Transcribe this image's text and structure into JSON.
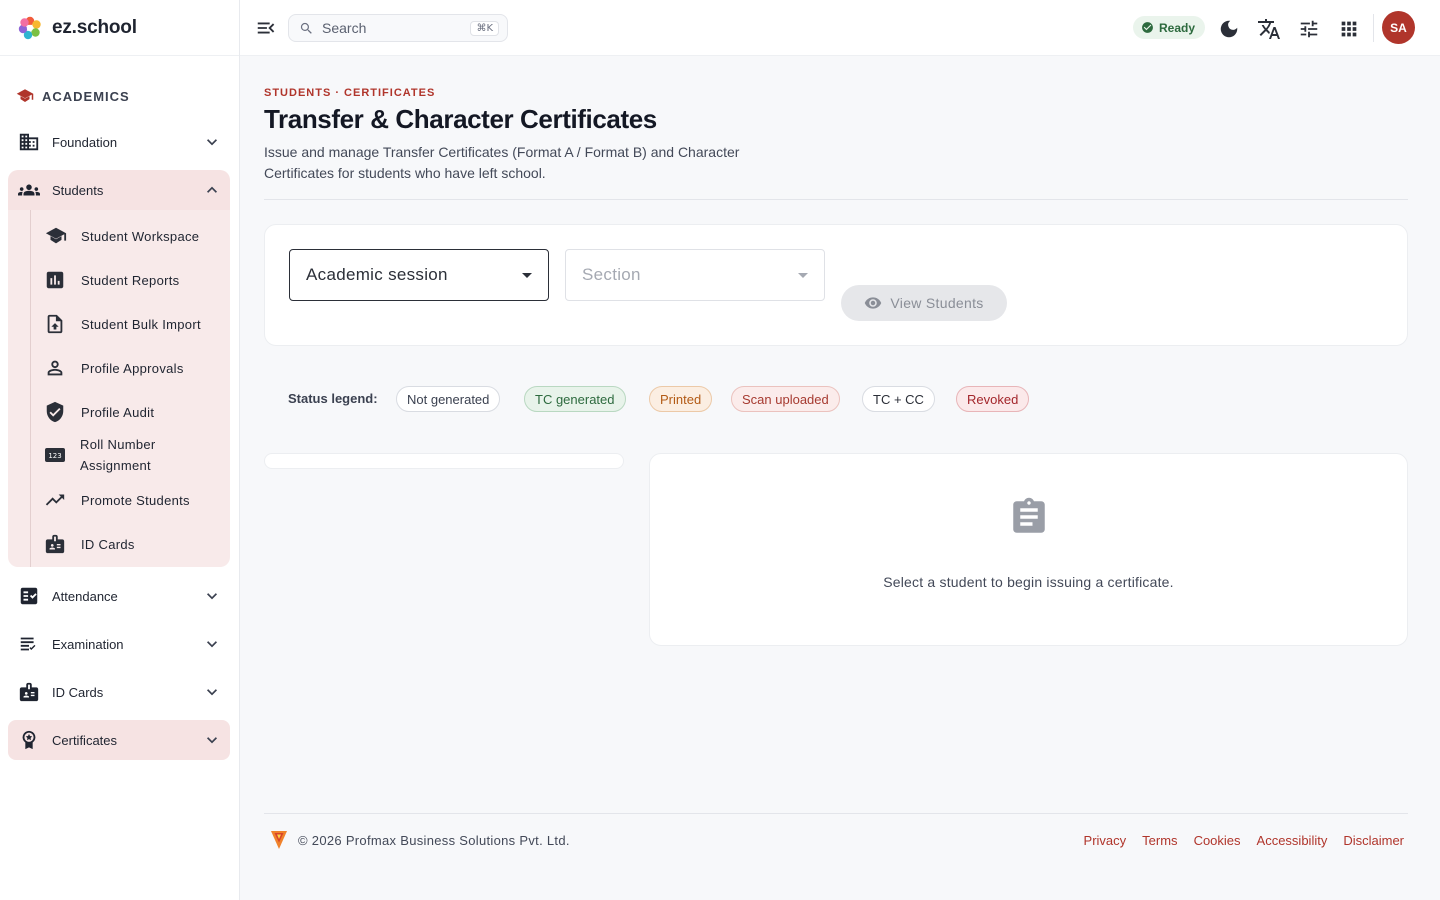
{
  "brand": {
    "name": "ez.school"
  },
  "sidebar": {
    "section": "ACADEMICS",
    "items": [
      {
        "label": "Foundation"
      },
      {
        "label": "Students"
      },
      {
        "label": "Attendance"
      },
      {
        "label": "Examination"
      },
      {
        "label": "ID Cards"
      },
      {
        "label": "Certificates"
      }
    ],
    "students_sub": [
      {
        "label": "Student Workspace"
      },
      {
        "label": "Student Reports"
      },
      {
        "label": "Student Bulk Import"
      },
      {
        "label": "Profile Approvals"
      },
      {
        "label": "Profile Audit"
      },
      {
        "label": "Roll Number Assignment"
      },
      {
        "label": "Promote Students"
      },
      {
        "label": "ID Cards"
      }
    ]
  },
  "topbar": {
    "search_placeholder": "Search",
    "search_shortcut": "⌘K",
    "status": "Ready",
    "avatar_initials": "SA",
    "icons": [
      "moon-icon",
      "translate-icon",
      "tune-icon",
      "apps-grid-icon"
    ]
  },
  "page": {
    "breadcrumb": "STUDENTS · CERTIFICATES",
    "title": "Transfer & Character Certificates",
    "description": "Issue and manage Transfer Certificates (Format A / Format B) and Character Certificates for students who have left school."
  },
  "filters": {
    "session_label": "Academic session",
    "section_label": "Section",
    "view_button": "View Students"
  },
  "legend": {
    "label": "Status legend:",
    "chips": [
      {
        "label": "Not generated",
        "color": "#3b4150",
        "bg": "#ffffff",
        "border": "#d9dce2"
      },
      {
        "label": "TC generated",
        "color": "#2d6a3e",
        "bg": "#e8f3ea",
        "border": "#b9d8c1"
      },
      {
        "label": "Printed",
        "color": "#b25a15",
        "bg": "#fbeee2",
        "border": "#ecc9a7"
      },
      {
        "label": "Scan uploaded",
        "color": "#a63a30",
        "bg": "#fbeceb",
        "border": "#ebc2be"
      },
      {
        "label": "TC + CC",
        "color": "#2b2f38",
        "bg": "#ffffff",
        "border": "#d9dce2"
      },
      {
        "label": "Revoked",
        "color": "#a3262b",
        "bg": "#fbe9ea",
        "border": "#e8b5b8"
      }
    ]
  },
  "empty_state": {
    "message": "Select a student to begin issuing a certificate."
  },
  "footer": {
    "copyright": "© 2026 Profmax Business Solutions Pvt. Ltd.",
    "links": [
      "Privacy",
      "Terms",
      "Cookies",
      "Accessibility",
      "Disclaimer"
    ]
  },
  "colors": {
    "accent": "#b0352b",
    "sidebar_active": "#f6e3e3",
    "ready_green": "#2d6a3e"
  }
}
